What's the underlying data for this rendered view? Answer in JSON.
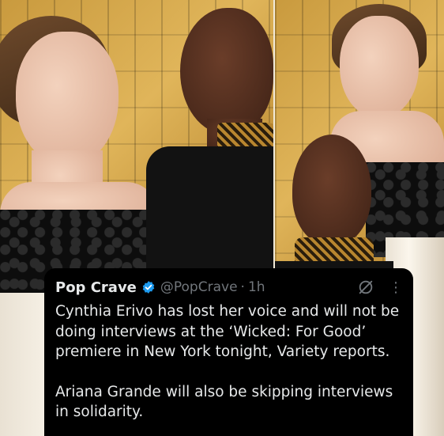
{
  "tweet": {
    "author_name": "Pop Crave",
    "handle": "@PopCrave",
    "separator": "·",
    "time": "1h",
    "more_label": "⋮",
    "paragraphs": [
      "Cynthia Erivo has lost her voice and will not be doing interviews at the ‘Wicked: For Good’ premiere in New York tonight, Variety reports.",
      "Ariana Grande will also be skipping interviews in solidarity."
    ]
  },
  "icons": {
    "verified": "verified-badge-icon",
    "grok": "grok-icon",
    "more": "more-icon"
  },
  "colors": {
    "card_background": "#000000",
    "primary_text": "#e7e9ea",
    "secondary_text": "#71767b",
    "verified_blue": "#1d9bf0",
    "backdrop_gold": "#d2a548"
  }
}
